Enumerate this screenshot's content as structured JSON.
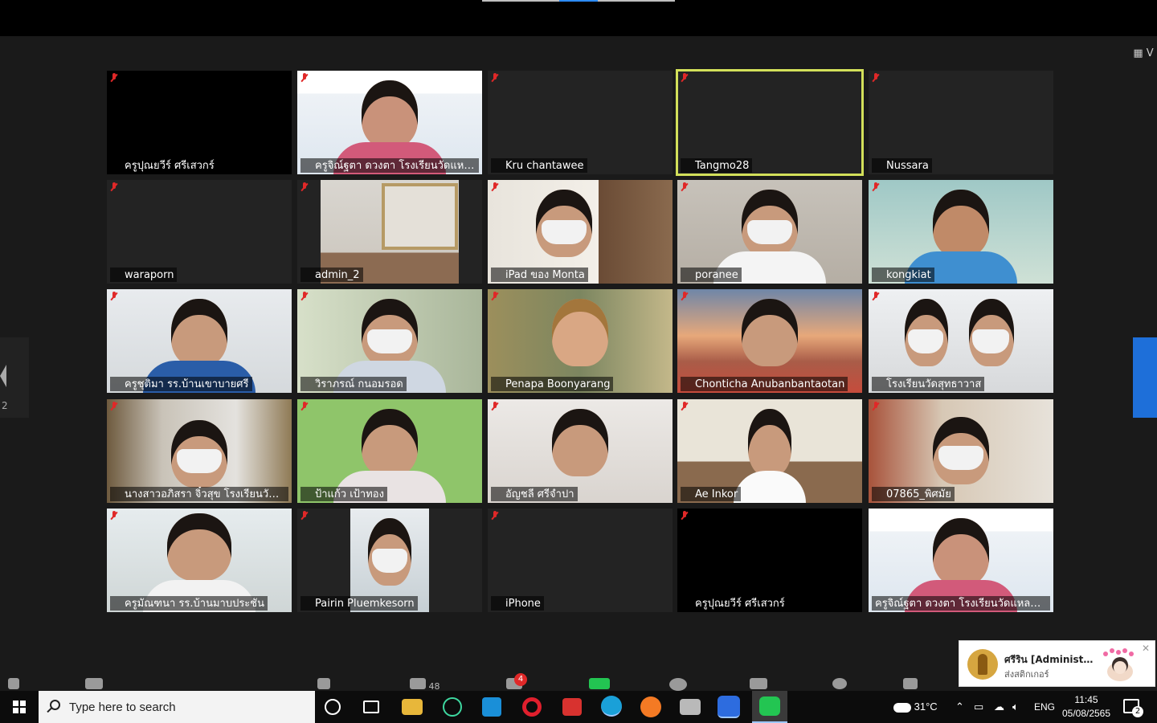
{
  "meeting": {
    "view_label": "V",
    "page_indicator": "2",
    "participant_count": "48",
    "chat_badge": "4",
    "participants": [
      {
        "name": "ครูปุณยวีร์ ศรีเสวกร์",
        "video": false
      },
      {
        "name": "ครูจิณ์ฐตา ดวงตา โรงเรียนวัดแหลมฉบัง",
        "video": true
      },
      {
        "name": "Kru chantawee",
        "video": false
      },
      {
        "name": "Tangmo28",
        "video": false,
        "active_speaker": true
      },
      {
        "name": "Nussara",
        "video": false
      },
      {
        "name": "waraporn",
        "video": false
      },
      {
        "name": "admin_2",
        "video": true
      },
      {
        "name": "iPad ของ Monta",
        "video": true
      },
      {
        "name": "poranee",
        "video": true
      },
      {
        "name": "kongkiat",
        "video": true
      },
      {
        "name": "ครูชุติมา รร.บ้านเขาบายศรี",
        "video": true
      },
      {
        "name": "วิราภรณ์ กนอมรอด",
        "video": true
      },
      {
        "name": "Penapa Boonyarang",
        "video": true
      },
      {
        "name": "Chonticha Anubanbantaotan",
        "video": true
      },
      {
        "name": "โรงเรียนวัดสุทธาวาส",
        "video": true
      },
      {
        "name": "นางสาวอภิสรา จิ๋วสุข โรงเรียนวัดแ...",
        "video": true
      },
      {
        "name": "ป้าแก้ว เป้าทอง",
        "video": true
      },
      {
        "name": "อัญชลี ศรีจำปา",
        "video": true
      },
      {
        "name": "Ae Inkor",
        "video": true
      },
      {
        "name": "07865_พิศมัย",
        "video": true
      },
      {
        "name": "ครูมัณฑนา รร.บ้านมาบประชัน",
        "video": true
      },
      {
        "name": "Pairin Pluemkesorn",
        "video": true
      },
      {
        "name": "iPhone",
        "video": false
      },
      {
        "name": "ครูปุณยวีร์ ศรีเสวกร์",
        "video": false
      },
      {
        "name": "ครูจิณ์ฐตา ดวงตา โรงเรียนวัดแหลมฉบัง",
        "video": true
      }
    ]
  },
  "notification": {
    "title": "ศรีริน [Administrat...",
    "message": "ส่งสติกเกอร์"
  },
  "taskbar": {
    "search_placeholder": "Type here to search",
    "weather": "31°C",
    "language": "ENG",
    "time": "11:45",
    "date": "05/08/2565",
    "notifications_count": "2"
  },
  "colors": {
    "active_speaker": "#d3e05a",
    "muted": "#e02828",
    "accent": "#1e6fd9"
  }
}
